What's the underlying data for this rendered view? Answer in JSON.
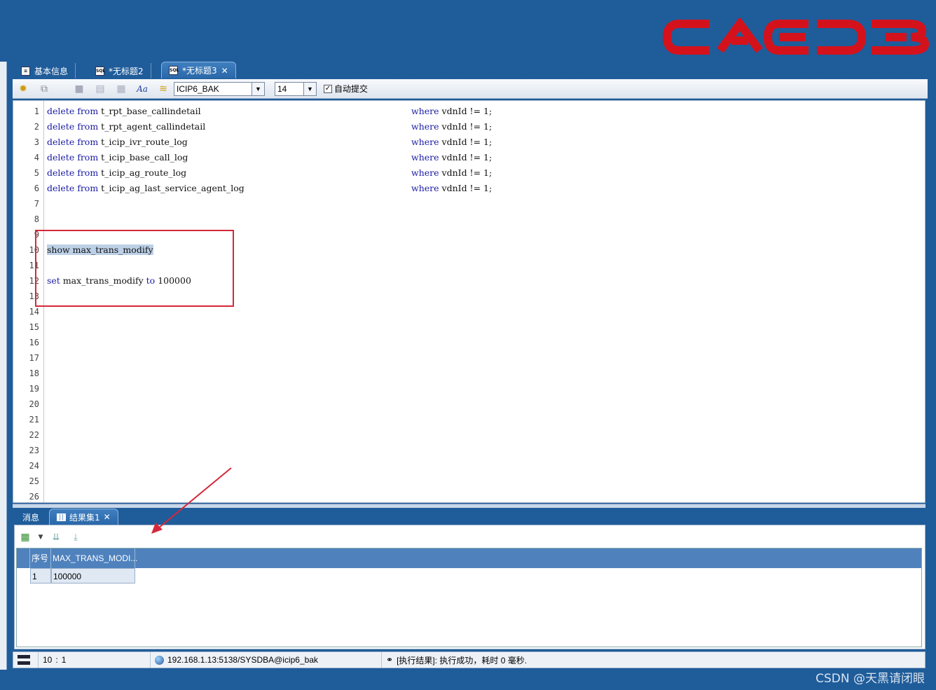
{
  "logo": {
    "text": "CAEDB",
    "color": "#d4121c"
  },
  "editor_tabs": [
    {
      "label": "基本信息",
      "icon": "document-icon"
    },
    {
      "label": "*无标题2",
      "icon": "sql-icon"
    },
    {
      "label": "*无标题3",
      "icon": "sql-icon",
      "active": true
    }
  ],
  "toolbar": {
    "connection_select": "ICIP6_BAK",
    "font_size_select": "14",
    "auto_commit_label": "自动提交",
    "auto_commit_checked": true
  },
  "editor": {
    "line_numbers": [
      "1",
      "2",
      "3",
      "4",
      "5",
      "6",
      "7",
      "8",
      "9",
      "10",
      "11",
      "12",
      "13",
      "14",
      "15",
      "16",
      "17",
      "18",
      "19",
      "20",
      "21",
      "22",
      "23",
      "24",
      "25",
      "26"
    ],
    "lines": [
      {
        "kw1": "delete",
        "kw2": "from",
        "table": "t_rpt_base_callindetail",
        "where_kw": "where",
        "cond": "vdnId != 1;"
      },
      {
        "kw1": "delete",
        "kw2": "from",
        "table": "t_rpt_agent_callindetail",
        "where_kw": "where",
        "cond": "vdnId != 1;"
      },
      {
        "kw1": "delete",
        "kw2": "from",
        "table": "t_icip_ivr_route_log",
        "where_kw": "where",
        "cond": "vdnId != 1;"
      },
      {
        "kw1": "delete",
        "kw2": "from",
        "table": "t_icip_base_call_log",
        "where_kw": "where",
        "cond": "vdnId != 1;"
      },
      {
        "kw1": "delete",
        "kw2": "from",
        "table": "t_icip_ag_route_log",
        "where_kw": "where",
        "cond": "vdnId != 1;"
      },
      {
        "kw1": "delete",
        "kw2": "from",
        "table": "t_icip_ag_last_service_agent_log",
        "where_kw": "where",
        "cond": "vdnId != 1;"
      }
    ],
    "show_stmt": "show max_trans_modify",
    "set_stmt": {
      "kw": "set",
      "name": "max_trans_modify",
      "to_kw": "to",
      "value": "100000"
    }
  },
  "result_tabs": [
    {
      "label": "消息"
    },
    {
      "label": "结果集1",
      "active": true
    }
  ],
  "result_table": {
    "columns": [
      "序号",
      "MAX_TRANS_MODI..."
    ],
    "rows": [
      [
        "1",
        "100000"
      ]
    ]
  },
  "status_bar": {
    "cursor_line": "10",
    "cursor_sep": ":",
    "cursor_col": "1",
    "connection": "192.168.1.13:5138/SYSDBA@icip6_bak",
    "message": "[执行结果]: 执行成功，耗时 0 毫秒."
  },
  "watermark": "CSDN @天黑请闭眼",
  "colors": {
    "keyword": "#1a1aa6",
    "frame": "#1f5c9a",
    "highlight_box": "#d5283a",
    "header_bg": "#4f82bd"
  }
}
